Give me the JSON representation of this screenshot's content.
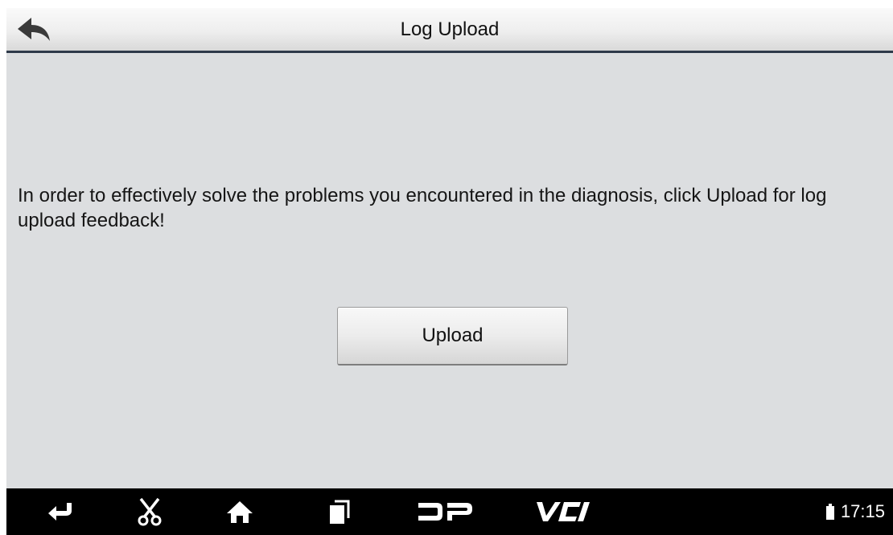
{
  "header": {
    "title": "Log Upload",
    "back_icon": "back-arrow-icon"
  },
  "main": {
    "message": "In order to effectively solve the problems you encountered in the diagnosis, click Upload for log upload feedback!",
    "upload_button_label": "Upload"
  },
  "navbar": {
    "icons": [
      "back-icon",
      "scissors-icon",
      "home-icon",
      "recent-apps-icon",
      "dp-icon",
      "vci-icon"
    ],
    "dp_label": "DP",
    "vci_label": "VCI"
  },
  "status": {
    "time": "17:15",
    "battery_icon": "battery-icon"
  },
  "colors": {
    "background": "#dcdee0",
    "header_border": "#2e3a4a",
    "navbar": "#000000"
  }
}
